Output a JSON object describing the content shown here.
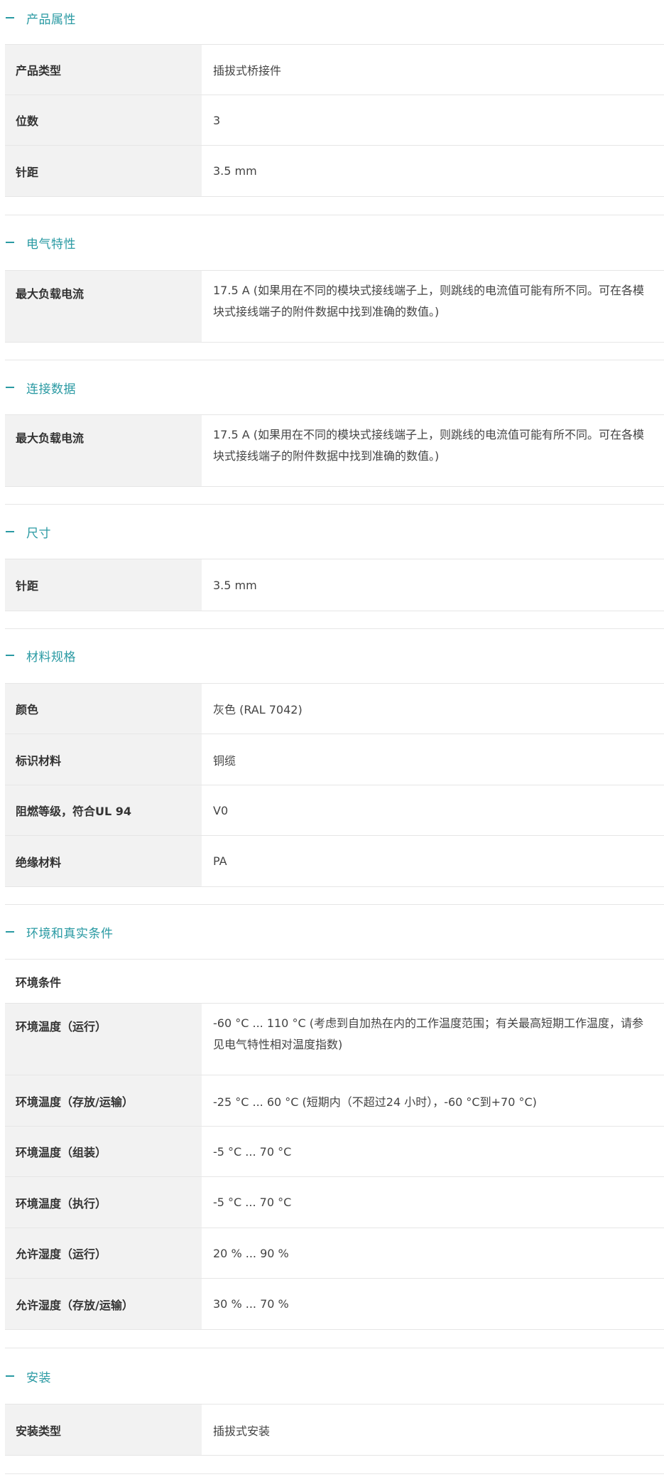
{
  "sections": {
    "product": {
      "title": "产品属性",
      "rows": [
        {
          "label": "产品类型",
          "value": "插拔式桥接件"
        },
        {
          "label": "位数",
          "value": "3"
        },
        {
          "label": "针距",
          "value": "3.5 mm"
        }
      ]
    },
    "electrical": {
      "title": "电气特性",
      "rows": [
        {
          "label": "最大负载电流",
          "value": "17.5 A (如果用在不同的模块式接线端子上，则跳线的电流值可能有所不同。可在各模块式接线端子的附件数据中找到准确的数值。)"
        }
      ]
    },
    "connection": {
      "title": "连接数据",
      "rows": [
        {
          "label": "最大负载电流",
          "value": "17.5 A (如果用在不同的模块式接线端子上，则跳线的电流值可能有所不同。可在各模块式接线端子的附件数据中找到准确的数值。)"
        }
      ]
    },
    "dimensions": {
      "title": "尺寸",
      "rows": [
        {
          "label": "针距",
          "value": "3.5 mm"
        }
      ]
    },
    "material": {
      "title": "材料规格",
      "rows": [
        {
          "label": "颜色",
          "value": "灰色 (RAL 7042)"
        },
        {
          "label": "标识材料",
          "value": "铜缆"
        },
        {
          "label": "阻燃等级，符合UL 94",
          "value": "V0"
        },
        {
          "label": "绝缘材料",
          "value": "PA"
        }
      ]
    },
    "environment": {
      "title": "环境和真实条件",
      "subhead": "环境条件",
      "rows": [
        {
          "label": "环境温度（运行）",
          "value": "-60 °C ... 110 °C (考虑到自加热在内的工作温度范围；有关最高短期工作温度，请参见电气特性相对温度指数)"
        },
        {
          "label": "环境温度（存放/运输）",
          "value": "-25 °C ... 60 °C (短期内（不超过24 小时），-60 °C到+70 °C)"
        },
        {
          "label": "环境温度（组装）",
          "value": "-5 °C ... 70 °C"
        },
        {
          "label": "环境温度（执行）",
          "value": "-5 °C ... 70 °C"
        },
        {
          "label": "允许湿度（运行）",
          "value": "20 % ... 90 %"
        },
        {
          "label": "允许湿度（存放/运输）",
          "value": "30 % ... 70 %"
        }
      ]
    },
    "installation": {
      "title": "安装",
      "rows": [
        {
          "label": "安装类型",
          "value": "插拔式安装"
        }
      ]
    }
  },
  "colors": {
    "accent": "#2a9aa3",
    "label_bg": "#f2f2f2",
    "border": "#e6e6e6"
  }
}
